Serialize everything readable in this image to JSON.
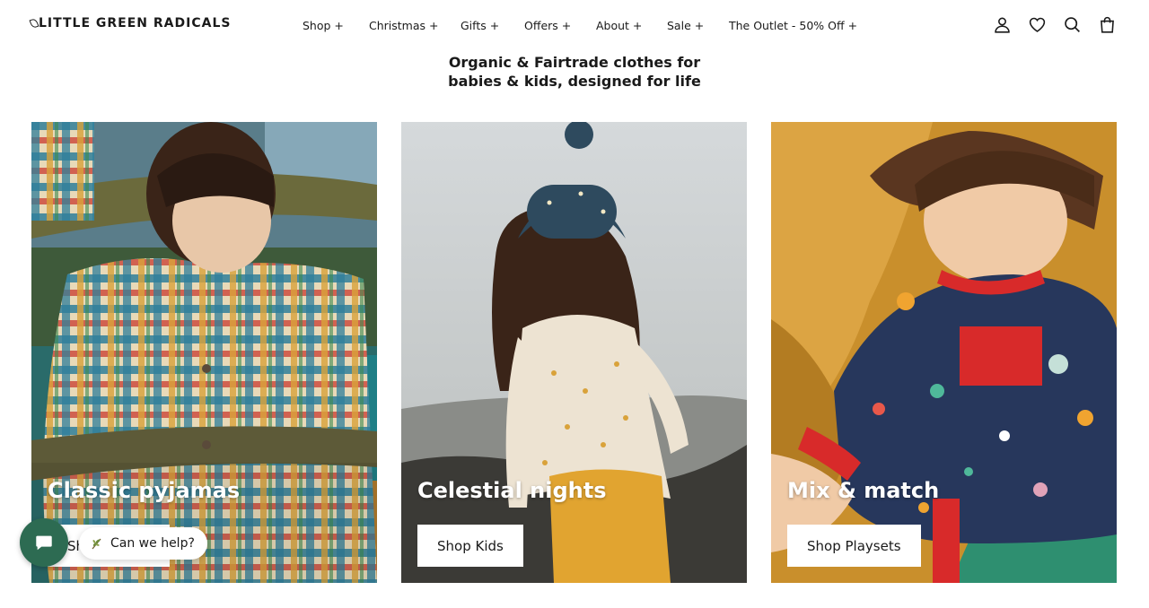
{
  "header": {
    "logo": "LITTLE GREEN RADICALS",
    "nav": [
      {
        "label": "Shop +"
      },
      {
        "label": "Christmas +"
      },
      {
        "label": "Gifts +"
      },
      {
        "label": "Offers +"
      },
      {
        "label": "About +"
      },
      {
        "label": "Sale +"
      },
      {
        "label": "The Outlet - 50% Off +"
      }
    ],
    "icons": [
      "account-icon",
      "wishlist-heart-icon",
      "search-icon",
      "cart-bag-icon"
    ]
  },
  "tagline": {
    "line1": "Organic & Fairtrade clothes for",
    "line2": "babies & kids, designed for life"
  },
  "cards": [
    {
      "title": "Classic pyjamas",
      "button": "Shop Winter"
    },
    {
      "title": "Celestial nights",
      "button": "Shop Kids"
    },
    {
      "title": "Mix & match",
      "button": "Shop Playsets"
    }
  ],
  "chat": {
    "prompt": "Can we help?",
    "bubble_color": "#2d6b52"
  }
}
